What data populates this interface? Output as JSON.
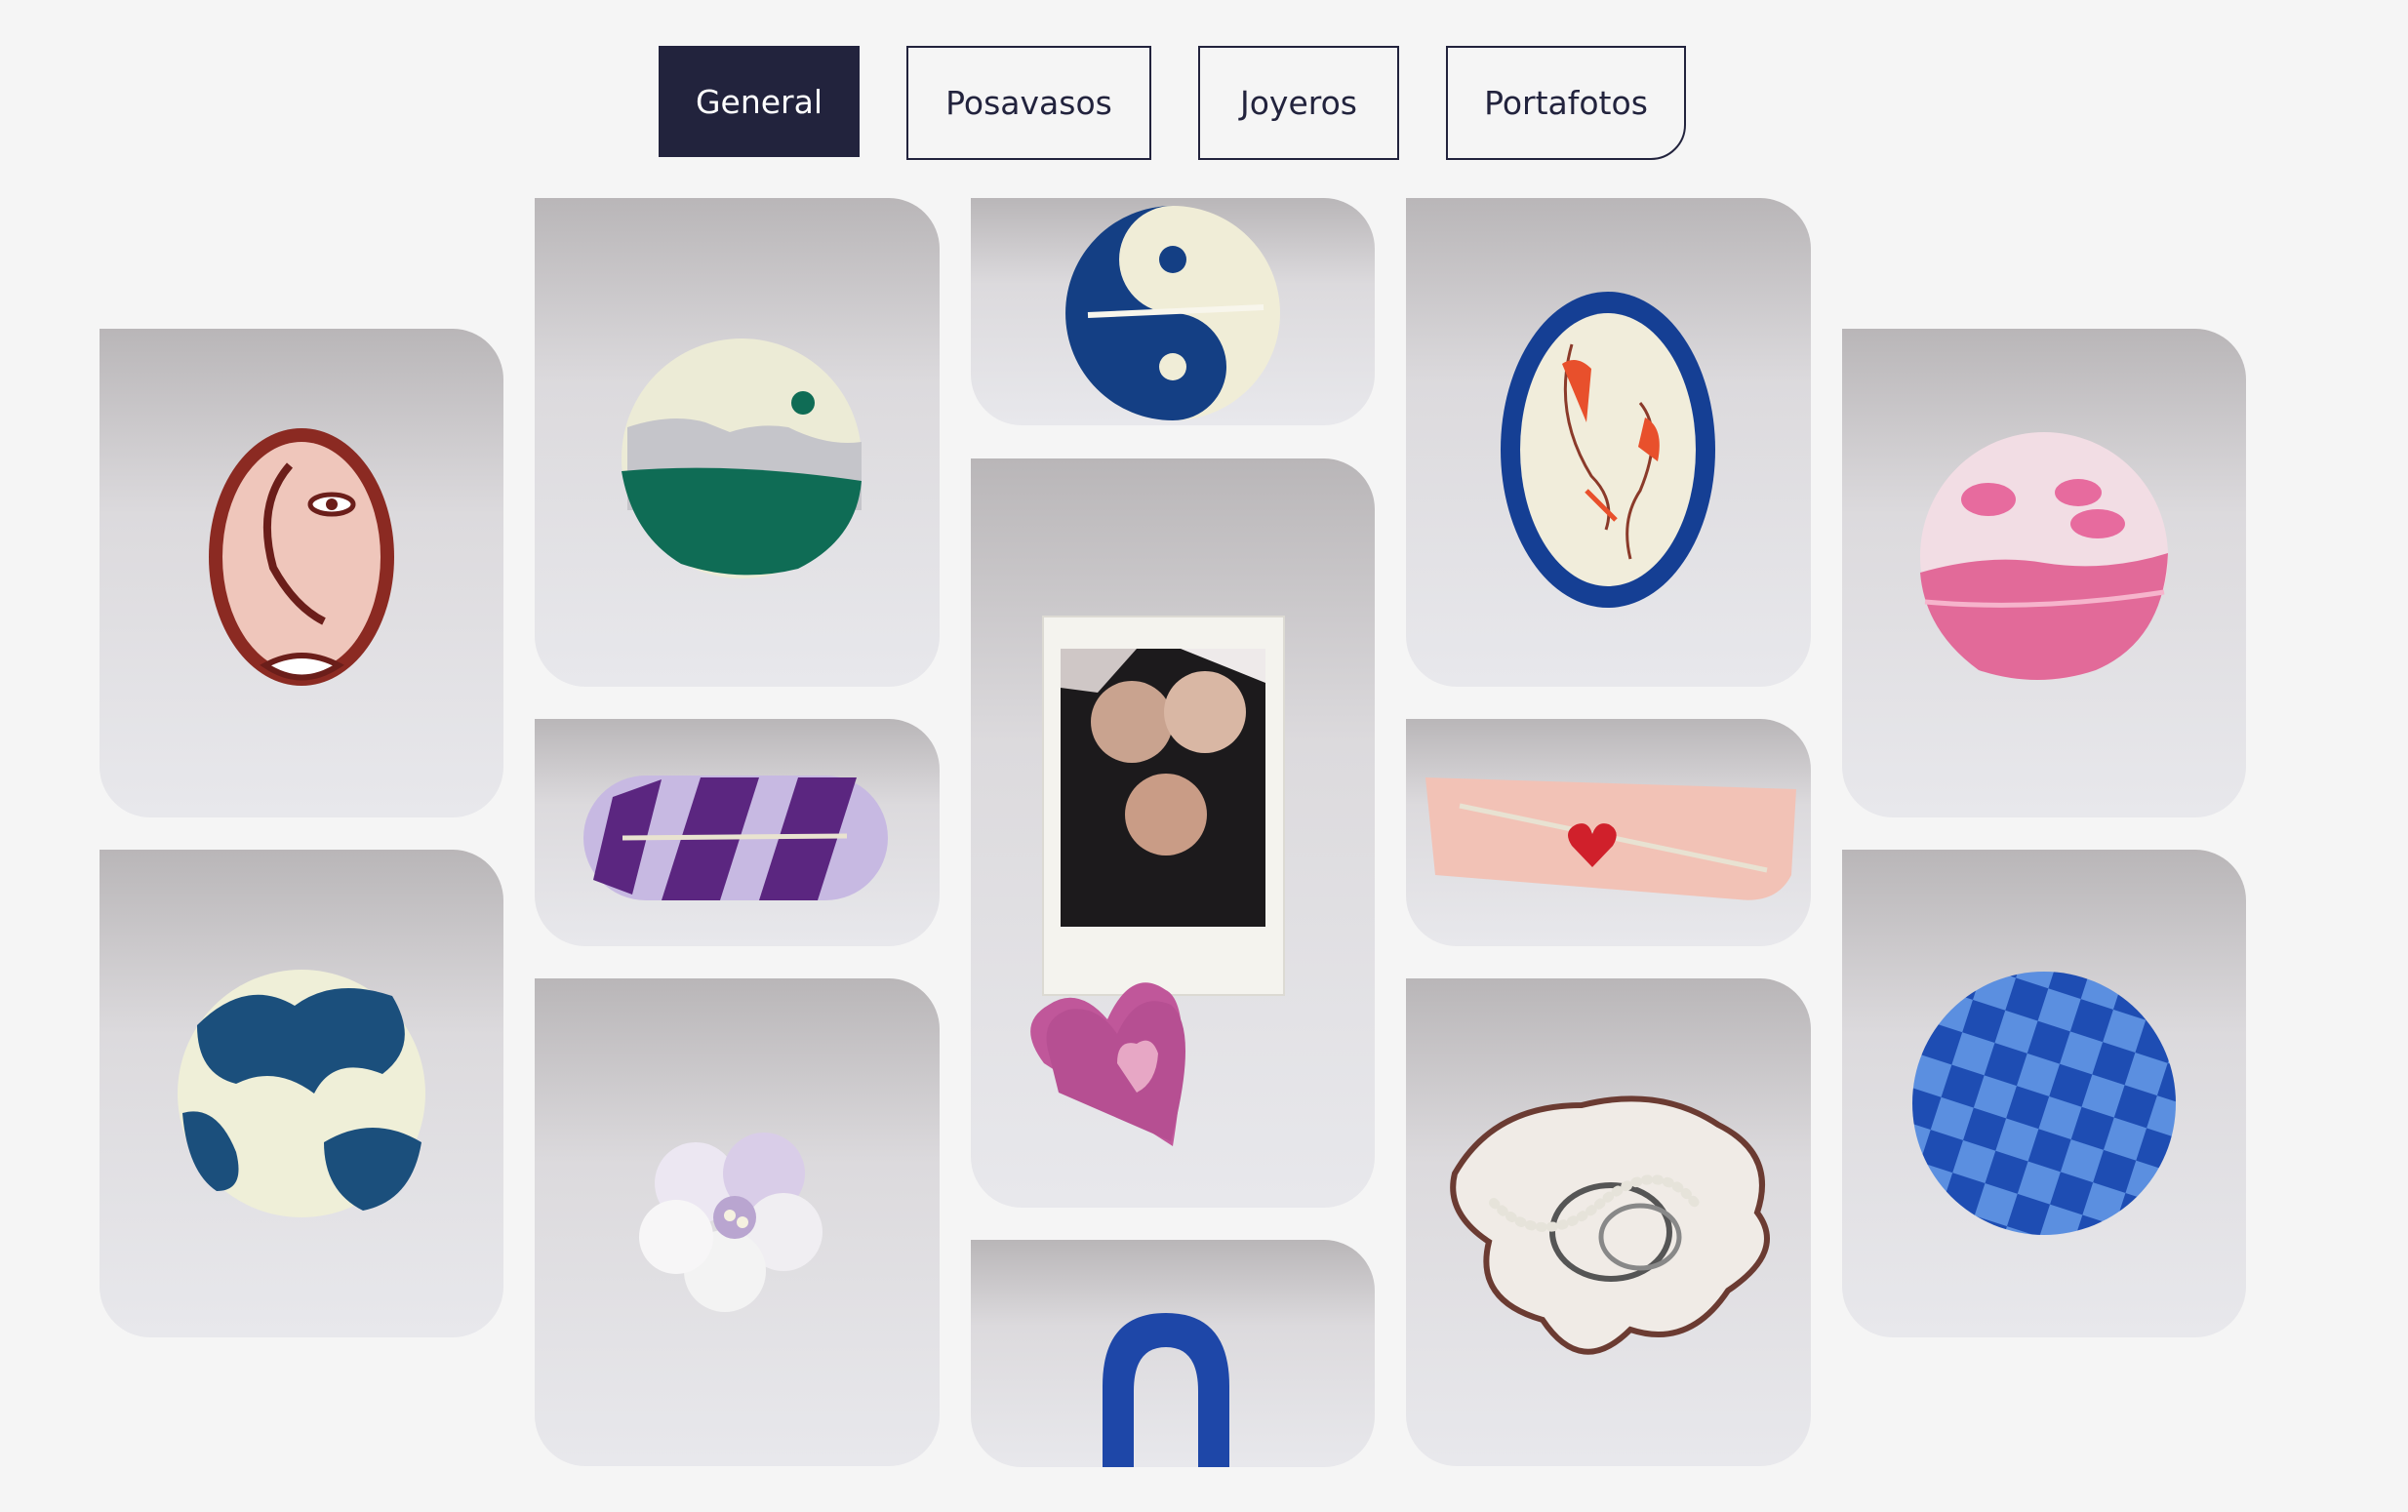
{
  "tabs": [
    {
      "label": "General",
      "active": true
    },
    {
      "label": "Posavasos",
      "active": false
    },
    {
      "label": "Joyeros",
      "active": false
    },
    {
      "label": "Portafotos",
      "active": false
    }
  ],
  "colors": {
    "accent": "#22233d",
    "background": "#f5f5f5"
  },
  "gallery": {
    "items": [
      {
        "name": "face-tray"
      },
      {
        "name": "moon-coaster"
      },
      {
        "name": "yin-yang-holder"
      },
      {
        "name": "koi-tray"
      },
      {
        "name": "pink-coaster"
      },
      {
        "name": "purple-stripe-holder"
      },
      {
        "name": "photo-frame-heart"
      },
      {
        "name": "heart-holder"
      },
      {
        "name": "cow-print-coaster"
      },
      {
        "name": "flower-holder"
      },
      {
        "name": "blue-arch"
      },
      {
        "name": "pearl-jewelry-dish"
      },
      {
        "name": "checker-coaster"
      }
    ]
  }
}
